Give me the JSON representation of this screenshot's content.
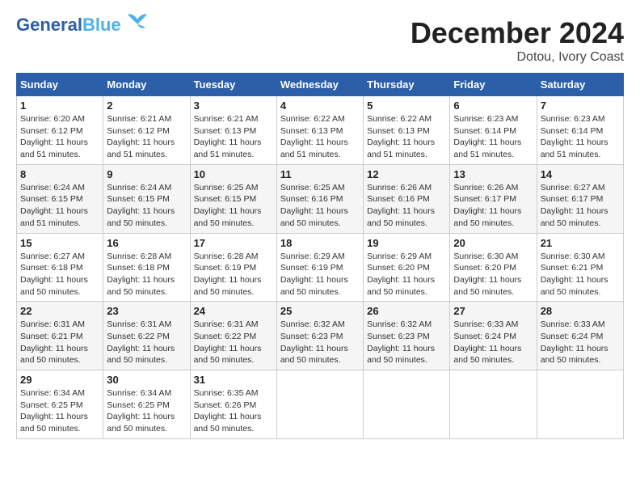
{
  "logo": {
    "part1": "General",
    "part2": "Blue"
  },
  "title": {
    "month": "December 2024",
    "location": "Dotou, Ivory Coast"
  },
  "headers": [
    "Sunday",
    "Monday",
    "Tuesday",
    "Wednesday",
    "Thursday",
    "Friday",
    "Saturday"
  ],
  "weeks": [
    [
      {
        "day": "1",
        "info": "Sunrise: 6:20 AM\nSunset: 6:12 PM\nDaylight: 11 hours\nand 51 minutes."
      },
      {
        "day": "2",
        "info": "Sunrise: 6:21 AM\nSunset: 6:12 PM\nDaylight: 11 hours\nand 51 minutes."
      },
      {
        "day": "3",
        "info": "Sunrise: 6:21 AM\nSunset: 6:13 PM\nDaylight: 11 hours\nand 51 minutes."
      },
      {
        "day": "4",
        "info": "Sunrise: 6:22 AM\nSunset: 6:13 PM\nDaylight: 11 hours\nand 51 minutes."
      },
      {
        "day": "5",
        "info": "Sunrise: 6:22 AM\nSunset: 6:13 PM\nDaylight: 11 hours\nand 51 minutes."
      },
      {
        "day": "6",
        "info": "Sunrise: 6:23 AM\nSunset: 6:14 PM\nDaylight: 11 hours\nand 51 minutes."
      },
      {
        "day": "7",
        "info": "Sunrise: 6:23 AM\nSunset: 6:14 PM\nDaylight: 11 hours\nand 51 minutes."
      }
    ],
    [
      {
        "day": "8",
        "info": "Sunrise: 6:24 AM\nSunset: 6:15 PM\nDaylight: 11 hours\nand 51 minutes."
      },
      {
        "day": "9",
        "info": "Sunrise: 6:24 AM\nSunset: 6:15 PM\nDaylight: 11 hours\nand 50 minutes."
      },
      {
        "day": "10",
        "info": "Sunrise: 6:25 AM\nSunset: 6:15 PM\nDaylight: 11 hours\nand 50 minutes."
      },
      {
        "day": "11",
        "info": "Sunrise: 6:25 AM\nSunset: 6:16 PM\nDaylight: 11 hours\nand 50 minutes."
      },
      {
        "day": "12",
        "info": "Sunrise: 6:26 AM\nSunset: 6:16 PM\nDaylight: 11 hours\nand 50 minutes."
      },
      {
        "day": "13",
        "info": "Sunrise: 6:26 AM\nSunset: 6:17 PM\nDaylight: 11 hours\nand 50 minutes."
      },
      {
        "day": "14",
        "info": "Sunrise: 6:27 AM\nSunset: 6:17 PM\nDaylight: 11 hours\nand 50 minutes."
      }
    ],
    [
      {
        "day": "15",
        "info": "Sunrise: 6:27 AM\nSunset: 6:18 PM\nDaylight: 11 hours\nand 50 minutes."
      },
      {
        "day": "16",
        "info": "Sunrise: 6:28 AM\nSunset: 6:18 PM\nDaylight: 11 hours\nand 50 minutes."
      },
      {
        "day": "17",
        "info": "Sunrise: 6:28 AM\nSunset: 6:19 PM\nDaylight: 11 hours\nand 50 minutes."
      },
      {
        "day": "18",
        "info": "Sunrise: 6:29 AM\nSunset: 6:19 PM\nDaylight: 11 hours\nand 50 minutes."
      },
      {
        "day": "19",
        "info": "Sunrise: 6:29 AM\nSunset: 6:20 PM\nDaylight: 11 hours\nand 50 minutes."
      },
      {
        "day": "20",
        "info": "Sunrise: 6:30 AM\nSunset: 6:20 PM\nDaylight: 11 hours\nand 50 minutes."
      },
      {
        "day": "21",
        "info": "Sunrise: 6:30 AM\nSunset: 6:21 PM\nDaylight: 11 hours\nand 50 minutes."
      }
    ],
    [
      {
        "day": "22",
        "info": "Sunrise: 6:31 AM\nSunset: 6:21 PM\nDaylight: 11 hours\nand 50 minutes."
      },
      {
        "day": "23",
        "info": "Sunrise: 6:31 AM\nSunset: 6:22 PM\nDaylight: 11 hours\nand 50 minutes."
      },
      {
        "day": "24",
        "info": "Sunrise: 6:31 AM\nSunset: 6:22 PM\nDaylight: 11 hours\nand 50 minutes."
      },
      {
        "day": "25",
        "info": "Sunrise: 6:32 AM\nSunset: 6:23 PM\nDaylight: 11 hours\nand 50 minutes."
      },
      {
        "day": "26",
        "info": "Sunrise: 6:32 AM\nSunset: 6:23 PM\nDaylight: 11 hours\nand 50 minutes."
      },
      {
        "day": "27",
        "info": "Sunrise: 6:33 AM\nSunset: 6:24 PM\nDaylight: 11 hours\nand 50 minutes."
      },
      {
        "day": "28",
        "info": "Sunrise: 6:33 AM\nSunset: 6:24 PM\nDaylight: 11 hours\nand 50 minutes."
      }
    ],
    [
      {
        "day": "29",
        "info": "Sunrise: 6:34 AM\nSunset: 6:25 PM\nDaylight: 11 hours\nand 50 minutes."
      },
      {
        "day": "30",
        "info": "Sunrise: 6:34 AM\nSunset: 6:25 PM\nDaylight: 11 hours\nand 50 minutes."
      },
      {
        "day": "31",
        "info": "Sunrise: 6:35 AM\nSunset: 6:26 PM\nDaylight: 11 hours\nand 50 minutes."
      },
      null,
      null,
      null,
      null
    ]
  ]
}
